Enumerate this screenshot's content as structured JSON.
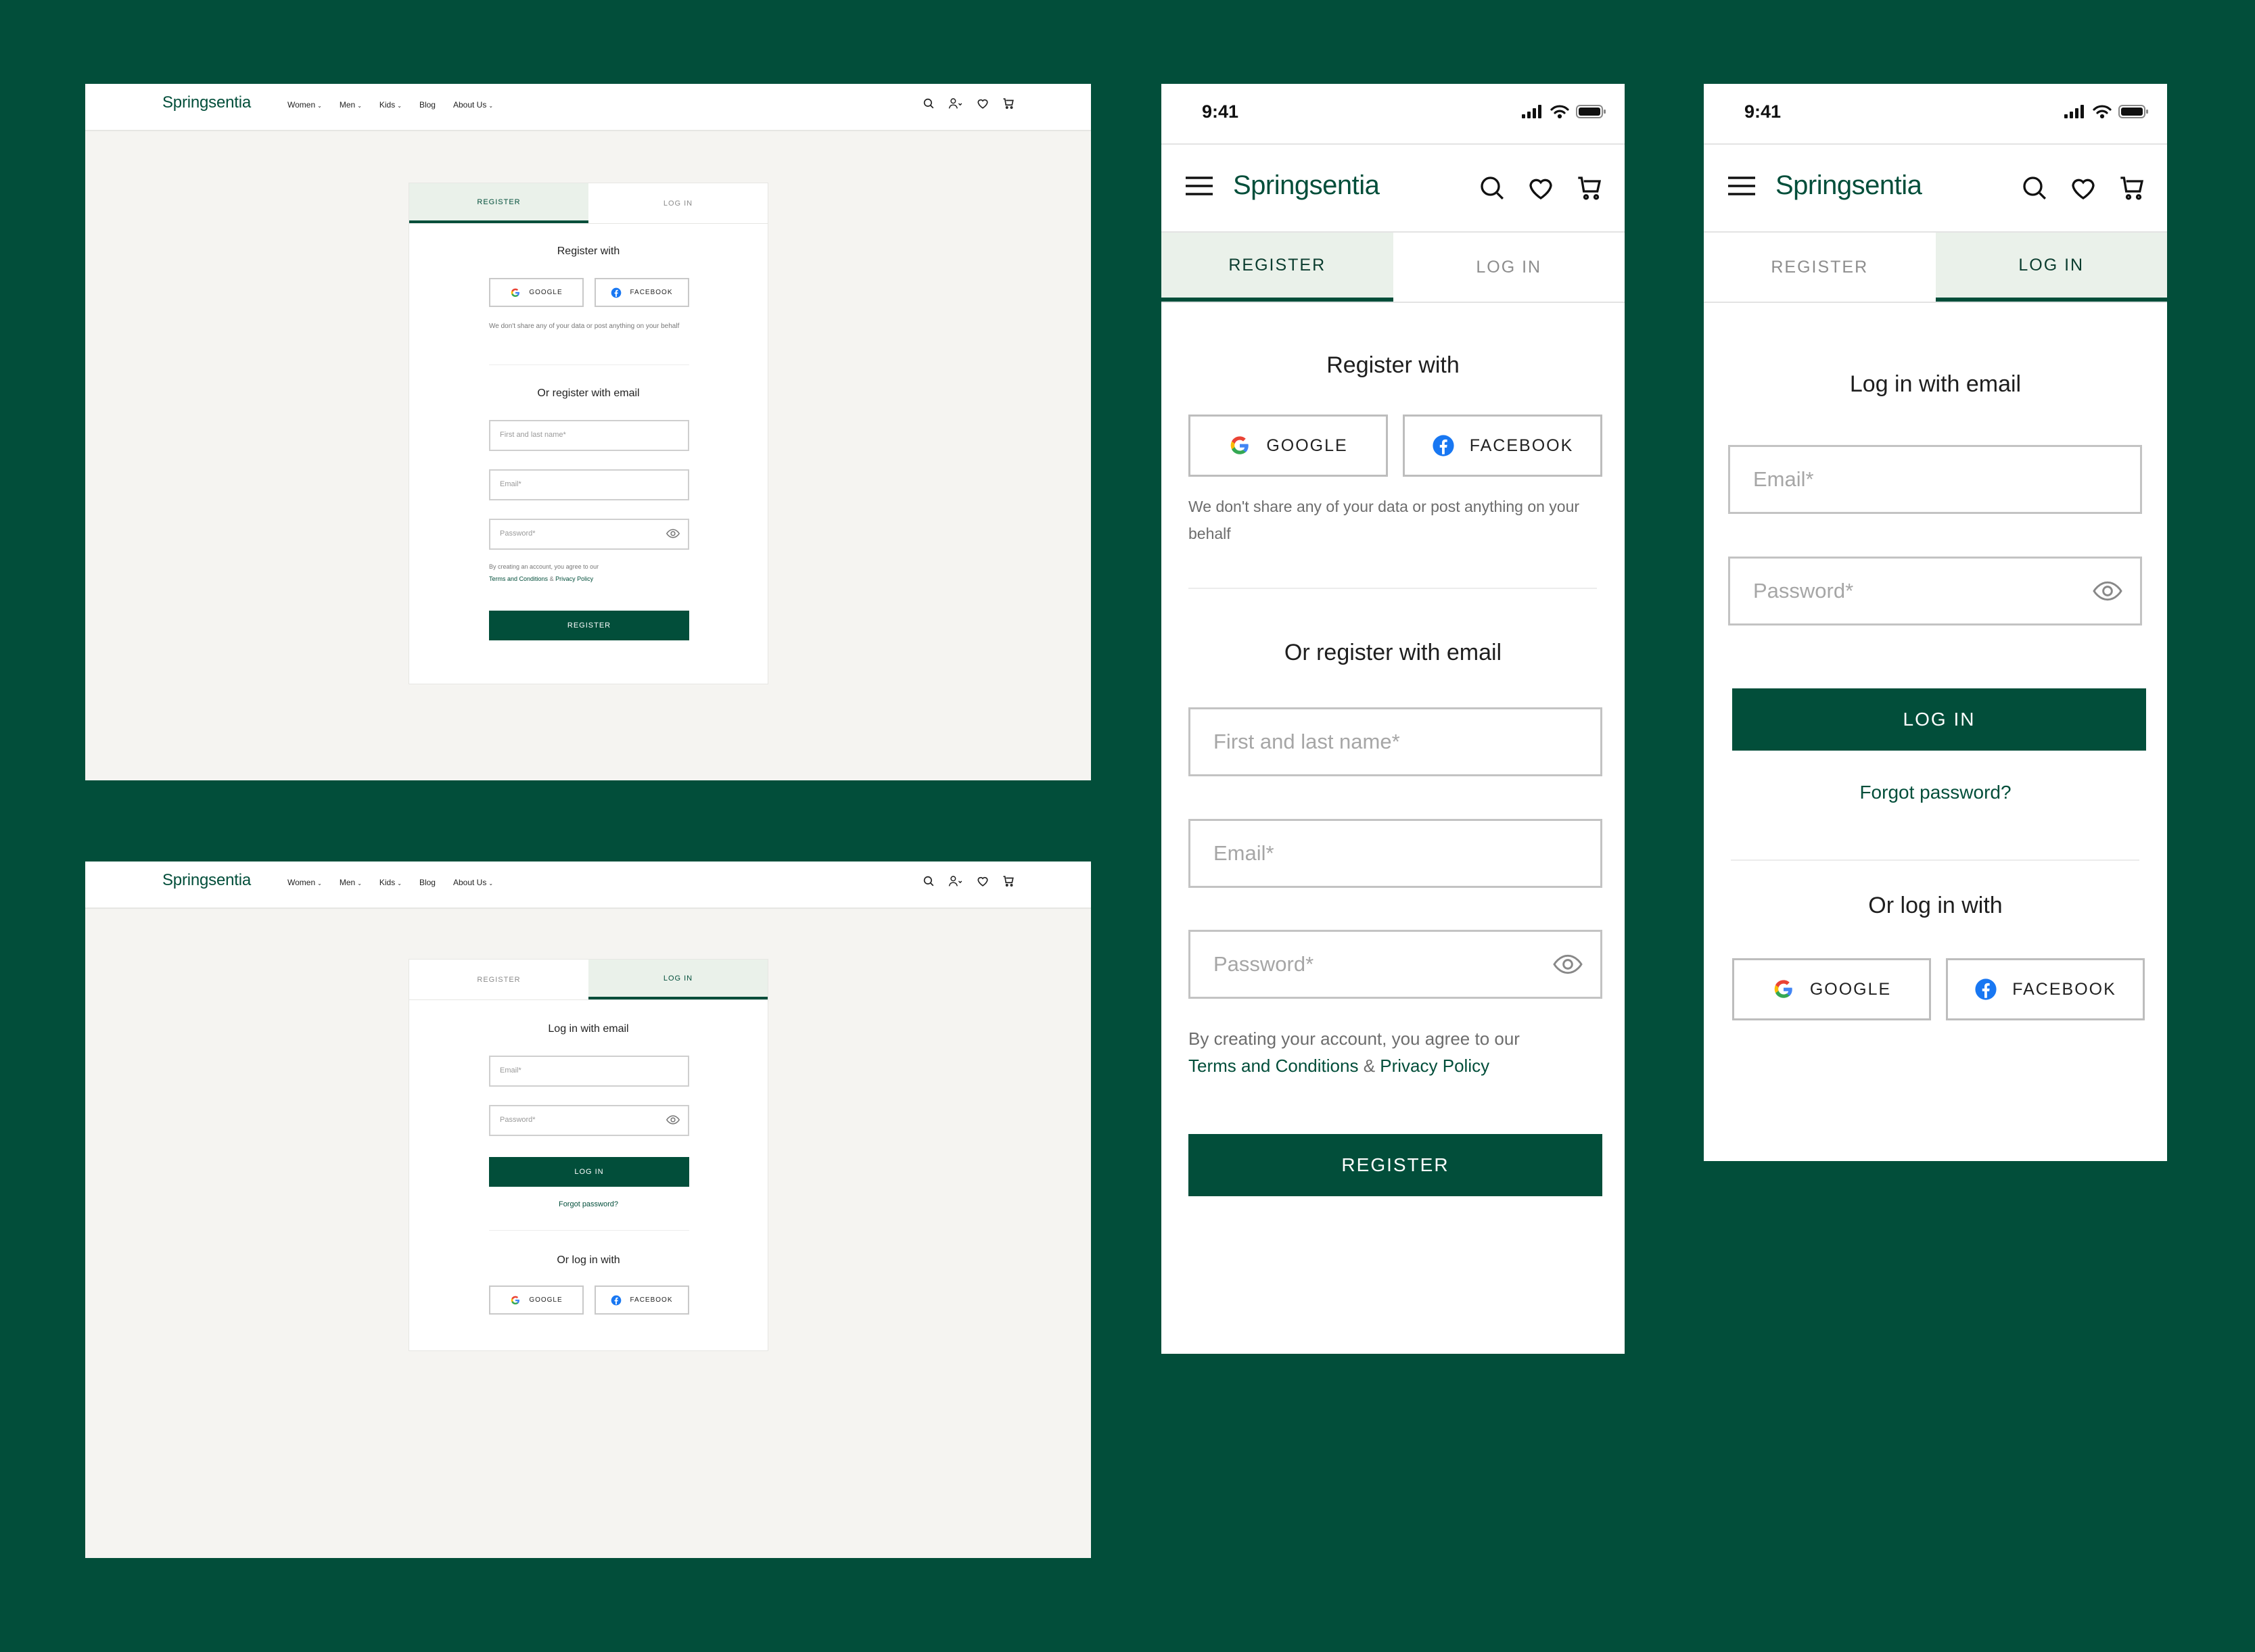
{
  "brand": "Springsentia",
  "nav": {
    "items": [
      {
        "label": "Women",
        "dropdown": true
      },
      {
        "label": "Men",
        "dropdown": true
      },
      {
        "label": "Kids",
        "dropdown": true
      },
      {
        "label": "Blog",
        "dropdown": false
      },
      {
        "label": "About Us",
        "dropdown": true
      }
    ],
    "chevron": "⌄",
    "icons": [
      "search-icon",
      "account-icon",
      "heart-icon",
      "cart-icon"
    ]
  },
  "status": {
    "time": "9:41"
  },
  "tabs": {
    "register": "REGISTER",
    "login": "LOG IN"
  },
  "register": {
    "heading": "Register with",
    "google": "GOOGLE",
    "facebook": "FACEBOOK",
    "privacy_note": "We don't share any of your data or post anything on your behalf",
    "email_heading": "Or register with email",
    "name_placeholder": "First and last name*",
    "email_placeholder": "Email*",
    "password_placeholder": "Password*",
    "consent_prefix": "By creating your account, you agree to our",
    "desktop_consent_prefix": "By creating an account, you agree to our",
    "terms": "Terms and Conditions",
    "amp": "&",
    "privacy": "Privacy Policy",
    "submit": "REGISTER"
  },
  "login": {
    "heading": "Log in with email",
    "email_placeholder": "Email*",
    "password_placeholder": "Password*",
    "submit": "LOG IN",
    "forgot": "Forgot password?",
    "social_heading": "Or log in with",
    "google": "GOOGLE",
    "facebook": "FACEBOOK"
  },
  "colors": {
    "background": "#024e3a",
    "brand": "#024e3a",
    "active_tab": "#eaf1ea",
    "desktop_canvas": "#f5f4f1",
    "facebook": "#1877f2"
  }
}
